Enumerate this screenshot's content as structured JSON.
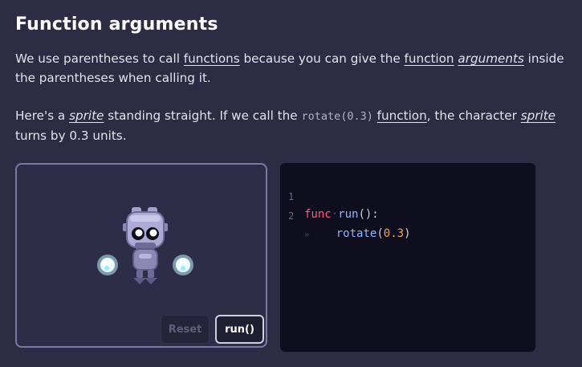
{
  "page": {
    "title": "Function arguments",
    "para1": {
      "t1": "We use parentheses to call ",
      "link_functions": "functions",
      "t2": " because you can give the ",
      "link_function": "function",
      "t3": " ",
      "em_arguments": "arguments",
      "t4": " inside the parentheses when calling it."
    },
    "para2": {
      "t1": "Here's a ",
      "em_sprite": "sprite",
      "t2": " standing straight. If we call the ",
      "code_rotate": "rotate(0.3)",
      "t3": " ",
      "link_function": "function",
      "t4": ", the character ",
      "em_sprite2": "sprite",
      "t5": " turns by 0.3 units."
    }
  },
  "sprite_panel": {
    "reset_label": "Reset",
    "run_label": "run()"
  },
  "code_editor": {
    "lines": [
      {
        "number": "1",
        "keyword": "func",
        "space_marker": "·",
        "name": "run",
        "punct": "():"
      },
      {
        "number": "2",
        "tab_marker": "»",
        "indent": "    ",
        "name": "rotate",
        "open": "(",
        "arg": "0.3",
        "close": ")"
      }
    ]
  },
  "colors": {
    "background": "#2d2c44",
    "panel_border": "#7b7aa6",
    "code_background": "#0f0e1f",
    "keyword": "#ff5a7a",
    "function_name": "#8fb4ff",
    "number": "#f0a45a"
  }
}
